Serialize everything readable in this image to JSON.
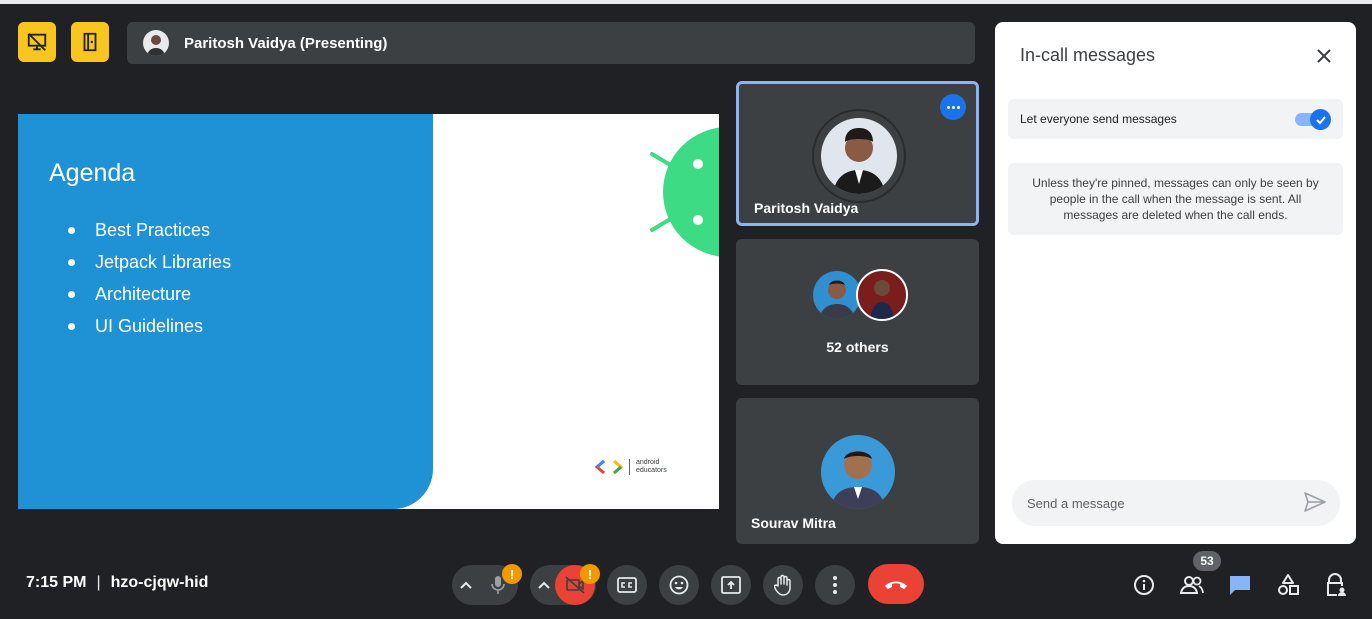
{
  "top_bar": {
    "presenter_label": "Paritosh Vaidya (Presenting)",
    "left_buttons": [
      "presentation-off-icon",
      "door-exit-icon"
    ]
  },
  "slide": {
    "title": "Agenda",
    "bullets": [
      "Best Practices",
      "Jetpack Libraries",
      "Architecture",
      "UI Guidelines"
    ],
    "logo_line1": "android",
    "logo_line2": "educators"
  },
  "tiles": {
    "pinned_name": "Paritosh Vaidya",
    "others_label": "52 others",
    "third_name": "Sourav Mitra"
  },
  "chat_panel": {
    "title": "In-call messages",
    "toggle_label": "Let everyone send messages",
    "toggle_on": true,
    "notice": "Unless they're pinned, messages can only be seen by people in the call when the message is sent. All messages are deleted when the call ends.",
    "input_placeholder": "Send a message"
  },
  "bottom_bar": {
    "time": "7:15 PM",
    "meeting_code": "hzo-cjqw-hid",
    "separator": "|",
    "warning_glyph": "!",
    "participant_count": "53"
  },
  "colors": {
    "background": "#202124",
    "accent": "#1a73e8",
    "leave": "#ea4335",
    "slide_blue": "#1f92d6",
    "warning": "#f29900",
    "highlight_button": "#f9c61f"
  }
}
